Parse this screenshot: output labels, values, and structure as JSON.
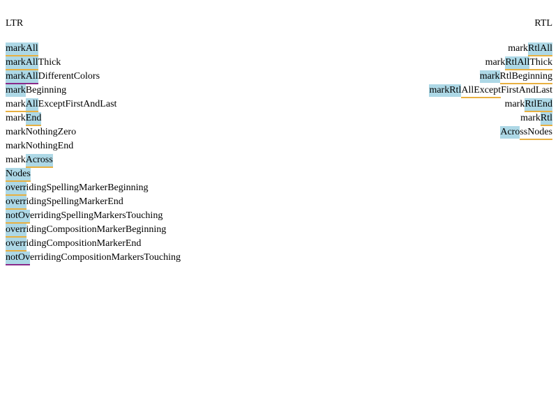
{
  "headings": {
    "ltr": "LTR",
    "rtl": "RTL"
  },
  "ltr_lines": [
    [
      {
        "t": "markAll",
        "hl": true,
        "ul": "orange"
      }
    ],
    [
      {
        "t": "markAll",
        "hl": true,
        "ul": "orange"
      },
      {
        "t": "Thick"
      }
    ],
    [
      {
        "t": "markAll",
        "hl": true,
        "ul": "purple"
      },
      {
        "t": "DifferentColors"
      }
    ],
    [
      {
        "t": "mark",
        "hl": true
      },
      {
        "t": "Beginning"
      }
    ],
    [
      {
        "t": "mark",
        "ul": "orange"
      },
      {
        "t": "All",
        "hl": true,
        "ul": "orange"
      },
      {
        "t": "ExceptFirstAndLast"
      }
    ],
    [
      {
        "t": "mark"
      },
      {
        "t": "End",
        "hl": true,
        "ul": "orange"
      }
    ],
    [
      {
        "t": "markNothingZero"
      }
    ],
    [
      {
        "t": "markNothingEnd"
      }
    ],
    [
      {
        "t": "mark"
      },
      {
        "t": "Across",
        "hl": true,
        "ul": "orange"
      }
    ],
    [
      {
        "t": "Nodes",
        "hl": true,
        "ul": "orange"
      }
    ],
    [
      {
        "t": "overr",
        "hl": true,
        "ul": "orange"
      },
      {
        "t": "idingSpellingMarkerBeginning"
      }
    ],
    [
      {
        "t": "overr",
        "hl": true,
        "ul": "orange"
      },
      {
        "t": "idingSpellingMarkerEnd"
      }
    ],
    [
      {
        "t": "notOv",
        "hl": true,
        "ul": "orange"
      },
      {
        "t": "erridingSpellingMarkersTouching"
      }
    ],
    [
      {
        "t": "overr",
        "hl": true,
        "ul": "orange"
      },
      {
        "t": "idingCompositionMarkerBeginning"
      }
    ],
    [
      {
        "t": "overr",
        "hl": true,
        "ul": "orange"
      },
      {
        "t": "idingCompositionMarkerEnd"
      }
    ],
    [
      {
        "t": "notOv",
        "hl": true,
        "ul": "purple"
      },
      {
        "t": "erridingCompositionMarkersTouching"
      }
    ]
  ],
  "rtl_lines": [
    [
      {
        "t": "mark"
      },
      {
        "t": "RtlAll",
        "hl": true,
        "ul": "orange"
      }
    ],
    [
      {
        "t": "mark"
      },
      {
        "t": "RtlAll",
        "hl": true,
        "ul": "orange"
      },
      {
        "t": "Thick",
        "ul": "orange"
      }
    ],
    [
      {
        "t": "mark",
        "hl": true
      },
      {
        "t": "RtlBeginning",
        "ul": "orange"
      }
    ],
    [
      {
        "t": "markRtl",
        "hl": true
      },
      {
        "t": "AllExcept",
        "ul": "orange"
      },
      {
        "t": "FirstAndLast"
      }
    ],
    [
      {
        "t": "mark"
      },
      {
        "t": "RtlEnd",
        "hl": true,
        "ul": "orange"
      }
    ],
    [
      {
        "t": "mark"
      },
      {
        "t": "Rtl",
        "hl": true,
        "ul": "orange"
      }
    ],
    [
      {
        "t": "Acro",
        "hl": true
      },
      {
        "t": "ssNodes",
        "ul": "orange"
      }
    ]
  ]
}
